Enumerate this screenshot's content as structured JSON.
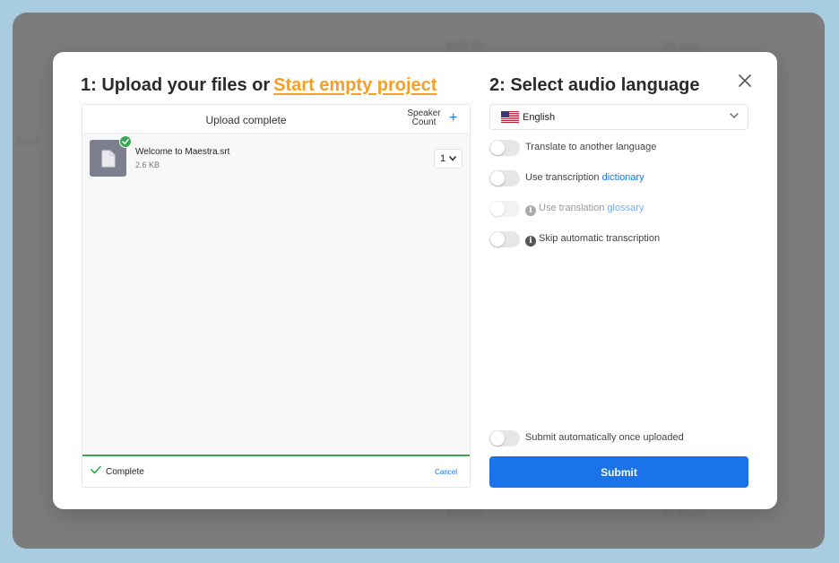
{
  "background": {
    "texts": [
      "5:03:40",
      "2th ago",
      "Boss",
      "5:05:22",
      "02-05-20"
    ]
  },
  "modal": {
    "left_title_prefix": "1: Upload your files or",
    "left_title_link": "Start empty project",
    "right_title": "2: Select audio language",
    "close_icon": "close-icon"
  },
  "upload": {
    "status": "Upload complete",
    "speaker_count_line1": "Speaker",
    "speaker_count_line2": "Count",
    "speaker_add": "+",
    "file": {
      "name": "Welcome to Maestra.srt",
      "size": "2.6 KB",
      "speaker_count": "1"
    },
    "footer_status": "Complete",
    "cancel": "Cancel"
  },
  "language": {
    "selected": "English",
    "flag_icon": "us-flag-icon"
  },
  "options": {
    "translate": "Translate to another language",
    "dictionary_prefix": "Use transcription",
    "dictionary_link": "dictionary",
    "glossary_prefix": "Use translation",
    "glossary_link": "glossary",
    "skip": "Skip automatic transcription",
    "auto_submit": "Submit automatically once uploaded"
  },
  "submit_label": "Submit",
  "colors": {
    "accent": "#1a73e8",
    "link_orange": "#f59f25",
    "success": "#34a853"
  }
}
